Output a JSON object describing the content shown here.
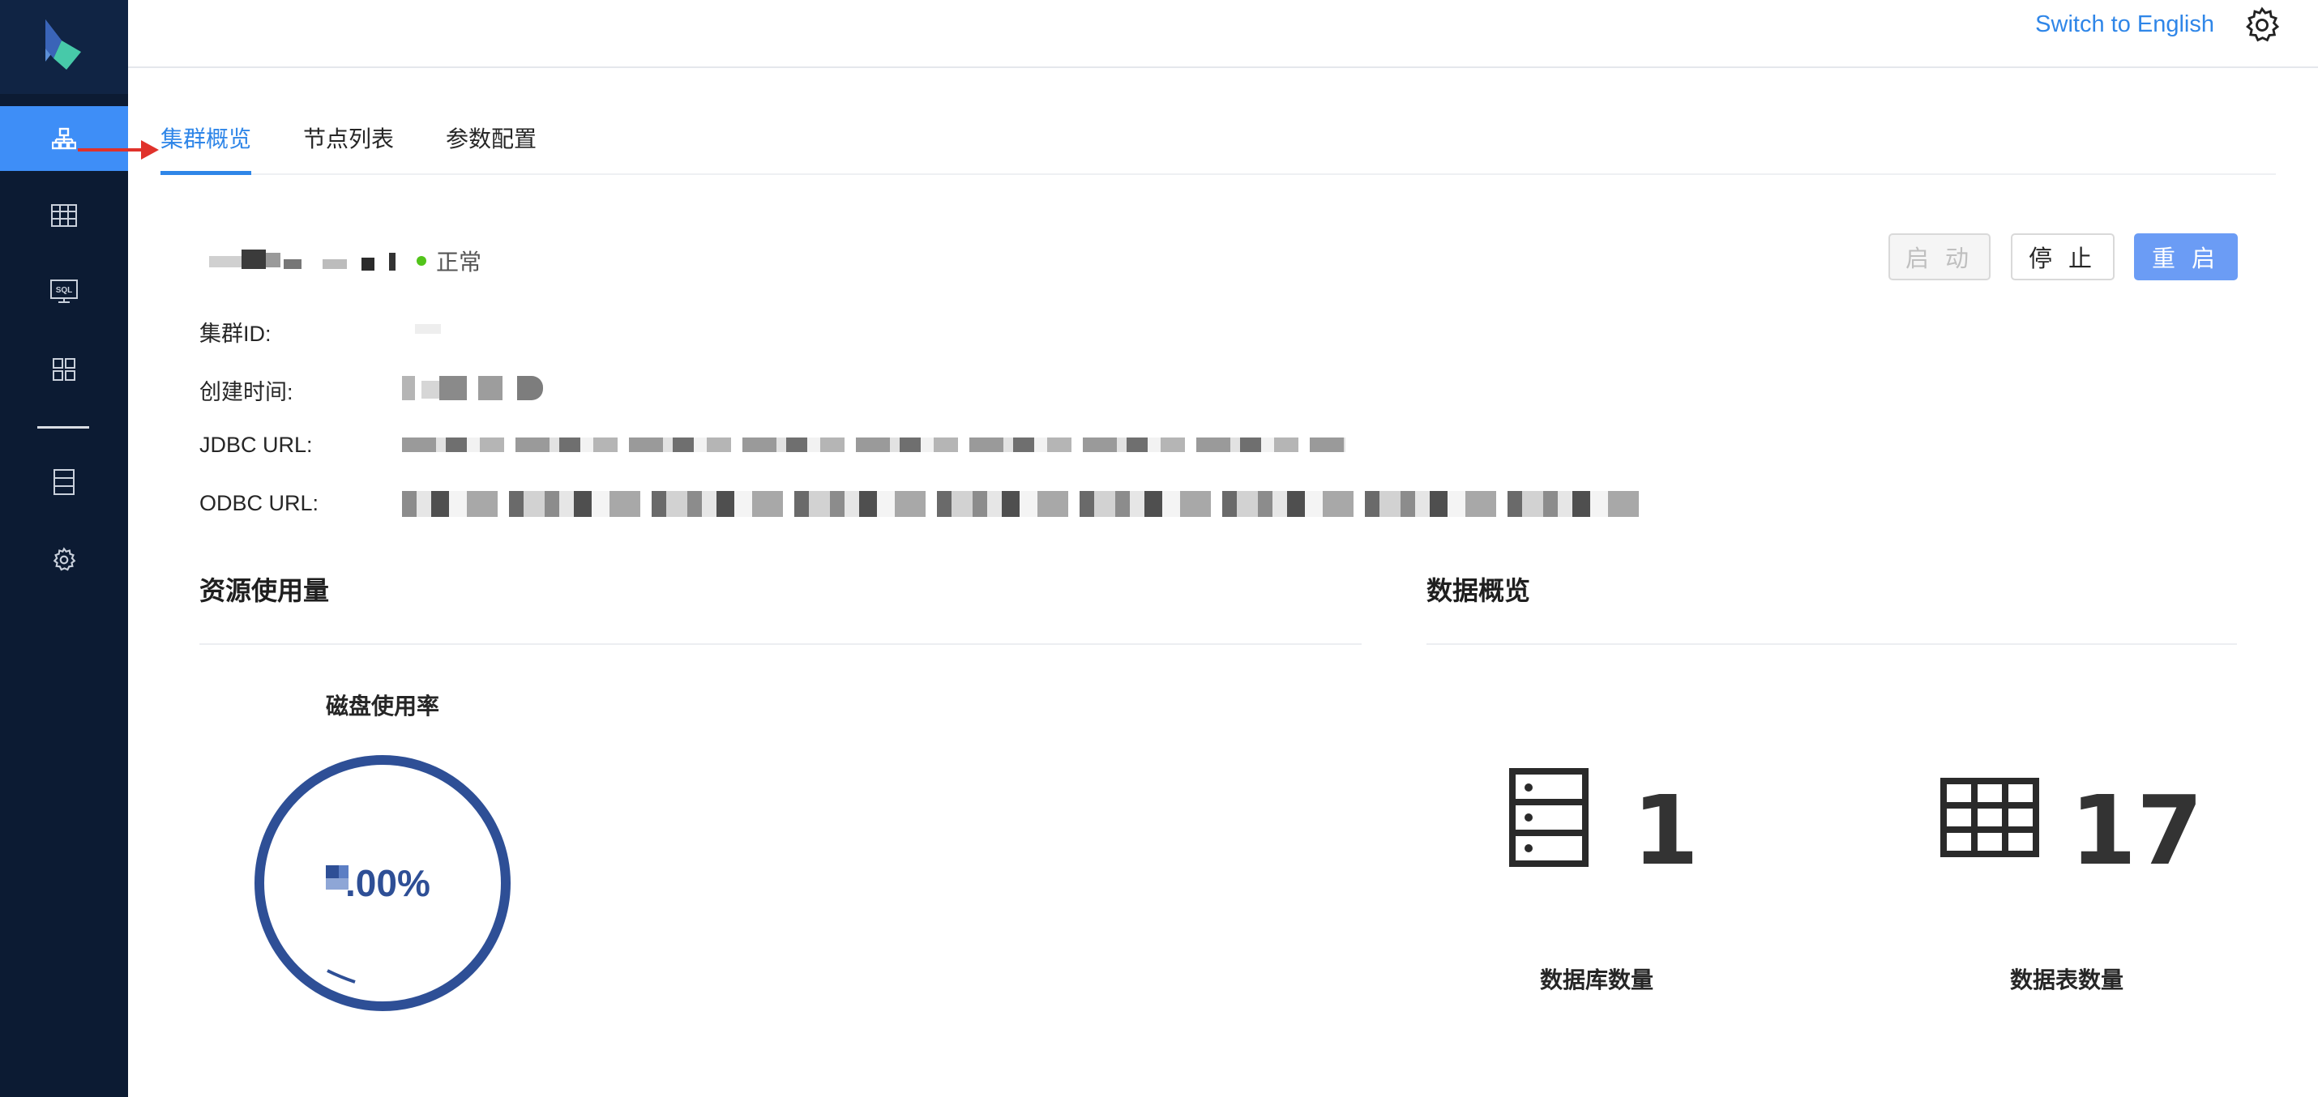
{
  "topbar": {
    "switch_language": "Switch to English",
    "settings_icon": "gear-icon"
  },
  "sidebar": {
    "logo_icon": "app-logo-icon",
    "items": [
      {
        "icon": "cluster-icon",
        "active": true
      },
      {
        "icon": "table-icon",
        "active": false
      },
      {
        "icon": "sql-icon",
        "active": false
      },
      {
        "icon": "grid-icon",
        "active": false
      },
      {
        "icon": "storage-icon",
        "active": false
      },
      {
        "icon": "gear-icon",
        "active": false
      }
    ]
  },
  "tabs": [
    {
      "label": "集群概览",
      "active": true
    },
    {
      "label": "节点列表",
      "active": false
    },
    {
      "label": "参数配置",
      "active": false
    }
  ],
  "cluster": {
    "status": "正常",
    "status_color": "#52c41a",
    "actions": {
      "start": "启 动",
      "stop": "停 止",
      "restart": "重 启"
    },
    "info_labels": {
      "cluster_id": "集群ID:",
      "created_at": "创建时间:",
      "jdbc_url": "JDBC URL:",
      "odbc_url": "ODBC URL:"
    }
  },
  "resource_usage": {
    "title": "资源使用量",
    "disk_usage_title": "磁盘使用率",
    "disk_usage_value_suffix": ".00%"
  },
  "data_overview": {
    "title": "数据概览",
    "database_count_label": "数据库数量",
    "database_count": "1",
    "table_count_label": "数据表数量",
    "table_count": "17"
  },
  "colors": {
    "accent": "#2f86e8",
    "sidebar_bg": "#0c1b33",
    "primary_button": "#6b9cf5",
    "gauge": "#2e4f96"
  }
}
